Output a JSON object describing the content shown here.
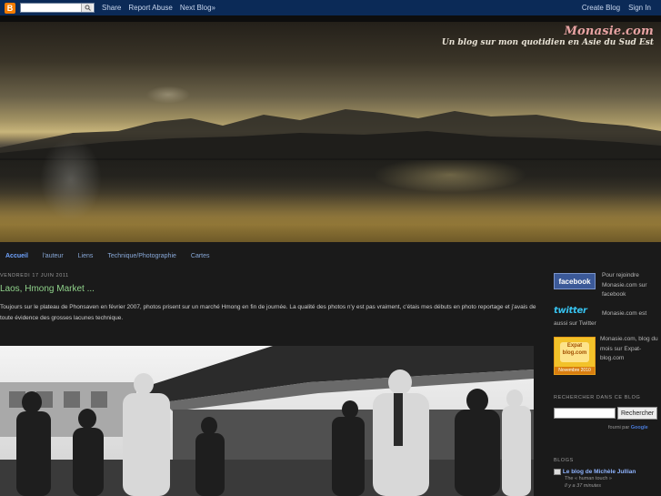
{
  "navbar": {
    "logo_glyph": "B",
    "search_placeholder": "",
    "search_icon": "magnifier-icon",
    "share": "Share",
    "report_abuse": "Report Abuse",
    "next_blog": "Next Blog»",
    "create_blog": "Create Blog",
    "sign_in": "Sign In"
  },
  "header": {
    "title": "Monasie.com",
    "description": "Un blog sur mon quotidien en Asie du Sud Est"
  },
  "tabs": [
    {
      "label": "Accueil"
    },
    {
      "label": "l'auteur"
    },
    {
      "label": "Liens"
    },
    {
      "label": "Technique/Photographie"
    },
    {
      "label": "Cartes"
    }
  ],
  "post": {
    "date": "vendredi 17 juin 2011",
    "title": "Laos, Hmong Market ...",
    "body": "Toujours sur le plateau de Phonsaven en février 2007, photos prisent sur un marché Hmong en fin de journée. La qualité des photos n'y est pas vraiment, c'étais mes débuts en photo reportage et j'avais de toute évidence des grosses lacunes technique."
  },
  "sidebar": {
    "facebook_badge": "facebook",
    "facebook_text": "Pour rejoindre Monasie.com sur facebook",
    "twitter_badge": "twitter",
    "twitter_text": "Monasie.com est aussi sur Twitter",
    "expat_badge_text": "Expat blog.com",
    "expat_ribbon": "Novembre 2010",
    "expat_text": "Monasie.com, blog du mois sur Expat-blog.com",
    "search_heading": "Rechercher dans ce blog",
    "search_button": "Rechercher",
    "google_prefix": "fourni par",
    "google_word": "Google",
    "blogs_heading": "Blogs",
    "blog_item_title": "Le blog de Michèle Jullian",
    "blog_item_sub": "The « human touch »",
    "blog_item_time": "Il y a 37 minutes"
  },
  "colors": {
    "navbar_bg": "#0b2a57",
    "page_bg": "#1a1a1a",
    "post_title": "#8fd18a",
    "tab_link": "#88a8d8",
    "facebook": "#3b5998",
    "twitter": "#37c3f0"
  }
}
